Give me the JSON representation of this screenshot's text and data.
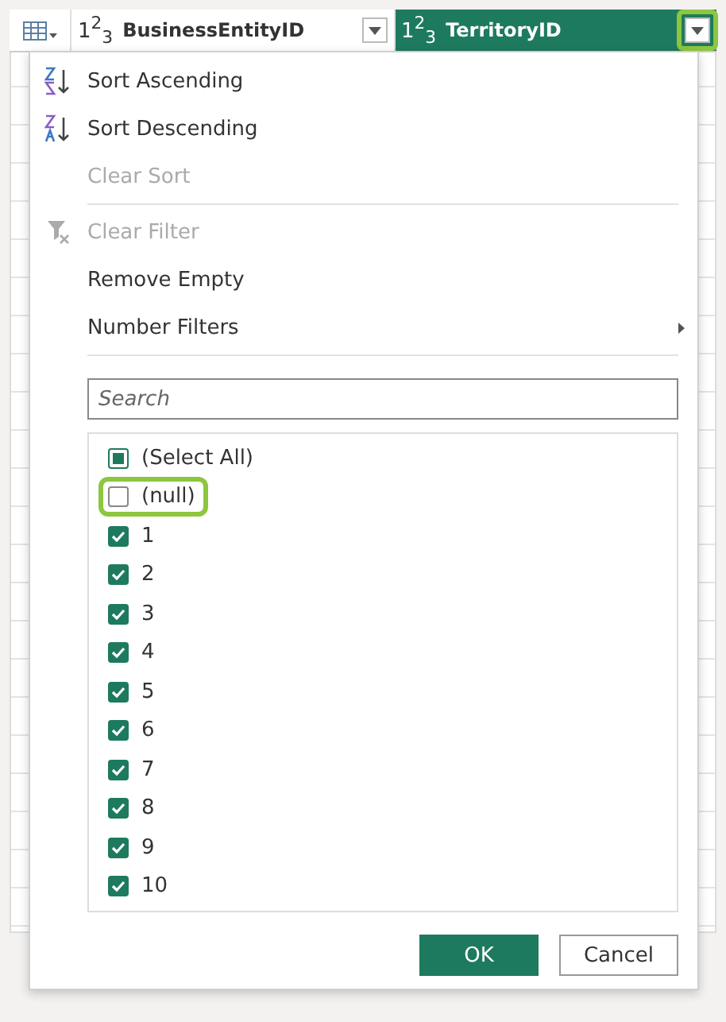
{
  "header": {
    "columns": [
      {
        "type": "1$^{2}$$_{3}$",
        "label": "BusinessEntityID",
        "selected": false,
        "highlighted": false
      },
      {
        "type": "1$^{2}$$_{3}$",
        "label": "TerritoryID",
        "selected": true,
        "highlighted": true
      }
    ]
  },
  "menu": {
    "items": [
      {
        "kind": "sort-asc",
        "label": "Sort Ascending",
        "disabled": false
      },
      {
        "kind": "sort-desc",
        "label": "Sort Descending",
        "disabled": false
      },
      {
        "kind": "plain",
        "label": "Clear Sort",
        "disabled": true
      },
      {
        "kind": "separator"
      },
      {
        "kind": "clear-filter",
        "label": "Clear Filter",
        "disabled": true
      },
      {
        "kind": "plain",
        "label": "Remove Empty",
        "disabled": false
      },
      {
        "kind": "submenu",
        "label": "Number Filters",
        "disabled": false
      },
      {
        "kind": "separator"
      }
    ],
    "search": {
      "placeholder": "Search"
    },
    "values": [
      {
        "label": "(Select All)",
        "mixed": true,
        "highlighted": false
      },
      {
        "label": "(null)",
        "checked": false,
        "highlighted": true
      },
      {
        "label": "1",
        "checked": true,
        "highlighted": false
      },
      {
        "label": "2",
        "checked": true,
        "highlighted": false
      },
      {
        "label": "3",
        "checked": true,
        "highlighted": false
      },
      {
        "label": "4",
        "checked": true,
        "highlighted": false
      },
      {
        "label": "5",
        "checked": true,
        "highlighted": false
      },
      {
        "label": "6",
        "checked": true,
        "highlighted": false
      },
      {
        "label": "7",
        "checked": true,
        "highlighted": false
      },
      {
        "label": "8",
        "checked": true,
        "highlighted": false
      },
      {
        "label": "9",
        "checked": true,
        "highlighted": false
      },
      {
        "label": "10",
        "checked": true,
        "highlighted": false
      }
    ],
    "buttons": [
      {
        "kind": "primary",
        "label": "OK"
      },
      {
        "kind": "secondary",
        "label": "Cancel"
      }
    ]
  }
}
